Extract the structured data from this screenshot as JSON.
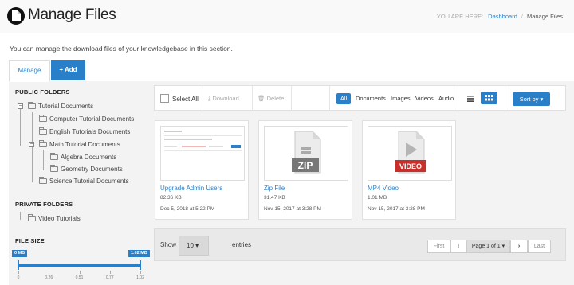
{
  "header": {
    "title": "Manage Files",
    "breadcrumb_prefix": "YOU ARE HERE:",
    "breadcrumb_link": "Dashboard",
    "breadcrumb_current": "Manage Files"
  },
  "intro_text": "You can manage the download files of your knowledgebase in this section.",
  "tabs": {
    "manage": "Manage",
    "add": "+ Add"
  },
  "sidebar": {
    "public_heading": "PUBLIC FOLDERS",
    "public_tree": [
      {
        "label": "Tutorial Documents"
      },
      {
        "label": "Computer Tutorial Documents"
      },
      {
        "label": "English Tutorials Documents"
      },
      {
        "label": "Math Tutorial Documents"
      },
      {
        "label": "Algebra Documents"
      },
      {
        "label": "Geometry Documents"
      },
      {
        "label": "Science Tutorial Documents"
      }
    ],
    "private_heading": "PRIVATE FOLDERS",
    "private_tree": [
      {
        "label": "Video Tutorials"
      }
    ],
    "filesize_heading": "FILE SIZE",
    "filesize_min": "0 MB",
    "filesize_max": "1.02 MB",
    "filesize_range_fraction": [
      0,
      1
    ],
    "scale_labels": [
      "0",
      "0.26",
      "0.51",
      "0.77",
      "1.02"
    ]
  },
  "toolbar": {
    "select_all": "Select All",
    "download": "Download",
    "delete": "Delete",
    "filters": [
      "All",
      "Documents",
      "Images",
      "Videos",
      "Audio"
    ],
    "active_filter": "All",
    "sort_label": "Sort by"
  },
  "files": [
    {
      "name": "Upgrade Admin Users",
      "size": "82.36 KB",
      "date": "Dec 5, 2018 at 5:22 PM",
      "thumb": "screenshot"
    },
    {
      "name": "Zip File",
      "size": "31.47 KB",
      "date": "Nov 15, 2017 at 3:28 PM",
      "thumb": "zip-icon",
      "badge": "ZIP",
      "badge_color": "#777777"
    },
    {
      "name": "MP4 Video",
      "size": "1.01 MB",
      "date": "Nov 15, 2017 at 3:28 PM",
      "thumb": "video-icon",
      "badge": "VIDEO",
      "badge_color": "#c9302c"
    }
  ],
  "pagination": {
    "show_label": "Show",
    "per_page": "10",
    "entries_label": "entries",
    "first": "First",
    "page_label": "Page 1 of 1",
    "last": "Last"
  },
  "colors": {
    "accent": "#2a7fc9"
  }
}
